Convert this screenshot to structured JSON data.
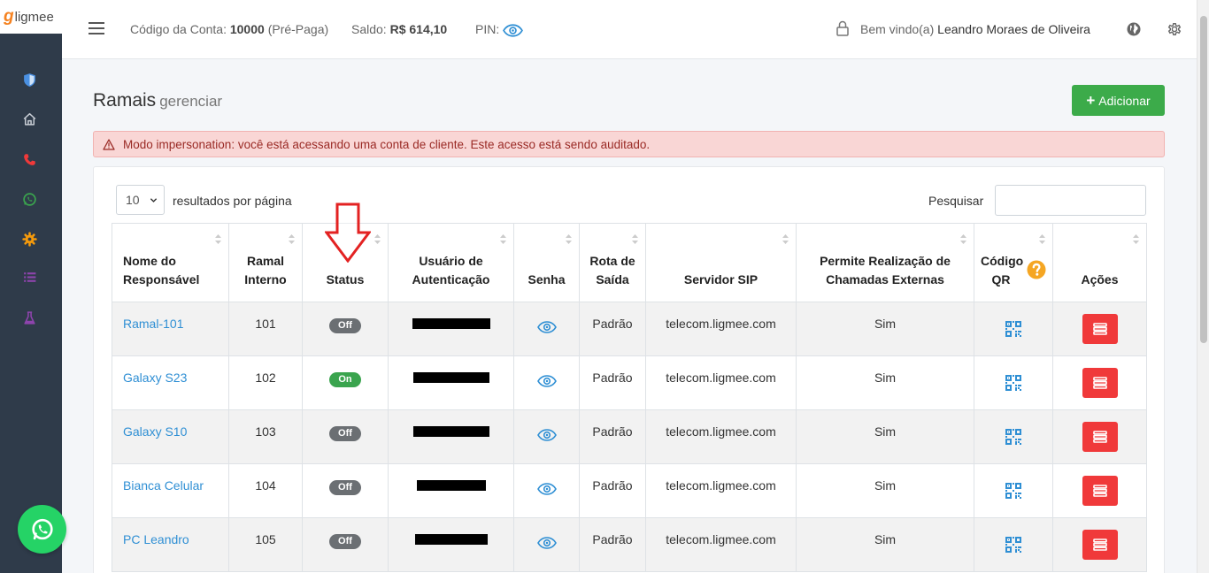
{
  "brand": {
    "logo_g": "g",
    "logo_text": "ligmee"
  },
  "topbar": {
    "account_label": "Código da Conta:",
    "account_value": "10000",
    "account_type": "(Pré-Paga)",
    "balance_label": "Saldo:",
    "balance_value": "R$ 614,10",
    "pin_label": "PIN:",
    "welcome_label": "Bem vindo(a)",
    "user_name": "Leandro Moraes de Oliveira"
  },
  "page": {
    "title": "Ramais",
    "subtitle": "gerenciar",
    "add_button": "Adicionar",
    "alert": "Modo impersonation: você está acessando uma conta de cliente. Este acesso está sendo auditado."
  },
  "table_controls": {
    "page_length": "10",
    "length_label": "resultados por página",
    "search_label": "Pesquisar",
    "search_value": ""
  },
  "table": {
    "headers": {
      "responsavel": "Nome do Responsável",
      "ramal": "Ramal Interno",
      "status": "Status",
      "usuario": "Usuário de Autenticação",
      "senha": "Senha",
      "rota": "Rota de Saída",
      "servidor": "Servidor SIP",
      "permite": "Permite Realização de Chamadas Externas",
      "codigo": "Código QR",
      "acoes": "Ações"
    },
    "rows": [
      {
        "name": "Ramal-101",
        "ramal": "101",
        "status": "Off",
        "rota": "Padrão",
        "servidor": "telecom.ligmee.com",
        "permite": "Sim"
      },
      {
        "name": "Galaxy S23",
        "ramal": "102",
        "status": "On",
        "rota": "Padrão",
        "servidor": "telecom.ligmee.com",
        "permite": "Sim"
      },
      {
        "name": "Galaxy S10",
        "ramal": "103",
        "status": "Off",
        "rota": "Padrão",
        "servidor": "telecom.ligmee.com",
        "permite": "Sim"
      },
      {
        "name": "Bianca Celular",
        "ramal": "104",
        "status": "Off",
        "rota": "Padrão",
        "servidor": "telecom.ligmee.com",
        "permite": "Sim"
      },
      {
        "name": "PC Leandro",
        "ramal": "105",
        "status": "Off",
        "rota": "Padrão",
        "servidor": "telecom.ligmee.com",
        "permite": "Sim"
      }
    ]
  },
  "colors": {
    "sidebar_bg": "#2f3b4a",
    "accent_blue": "#2f8fd4",
    "success_green": "#3aa44e",
    "danger_red": "#f0393a",
    "alert_bg": "#f9d6d5"
  },
  "icons": {
    "sidebar": [
      "shield-icon",
      "home-icon",
      "phone-icon",
      "whatsapp-icon",
      "gear-icon",
      "list-icon",
      "flask-icon"
    ],
    "top_right": [
      "globe-icon",
      "settings-icon"
    ]
  }
}
